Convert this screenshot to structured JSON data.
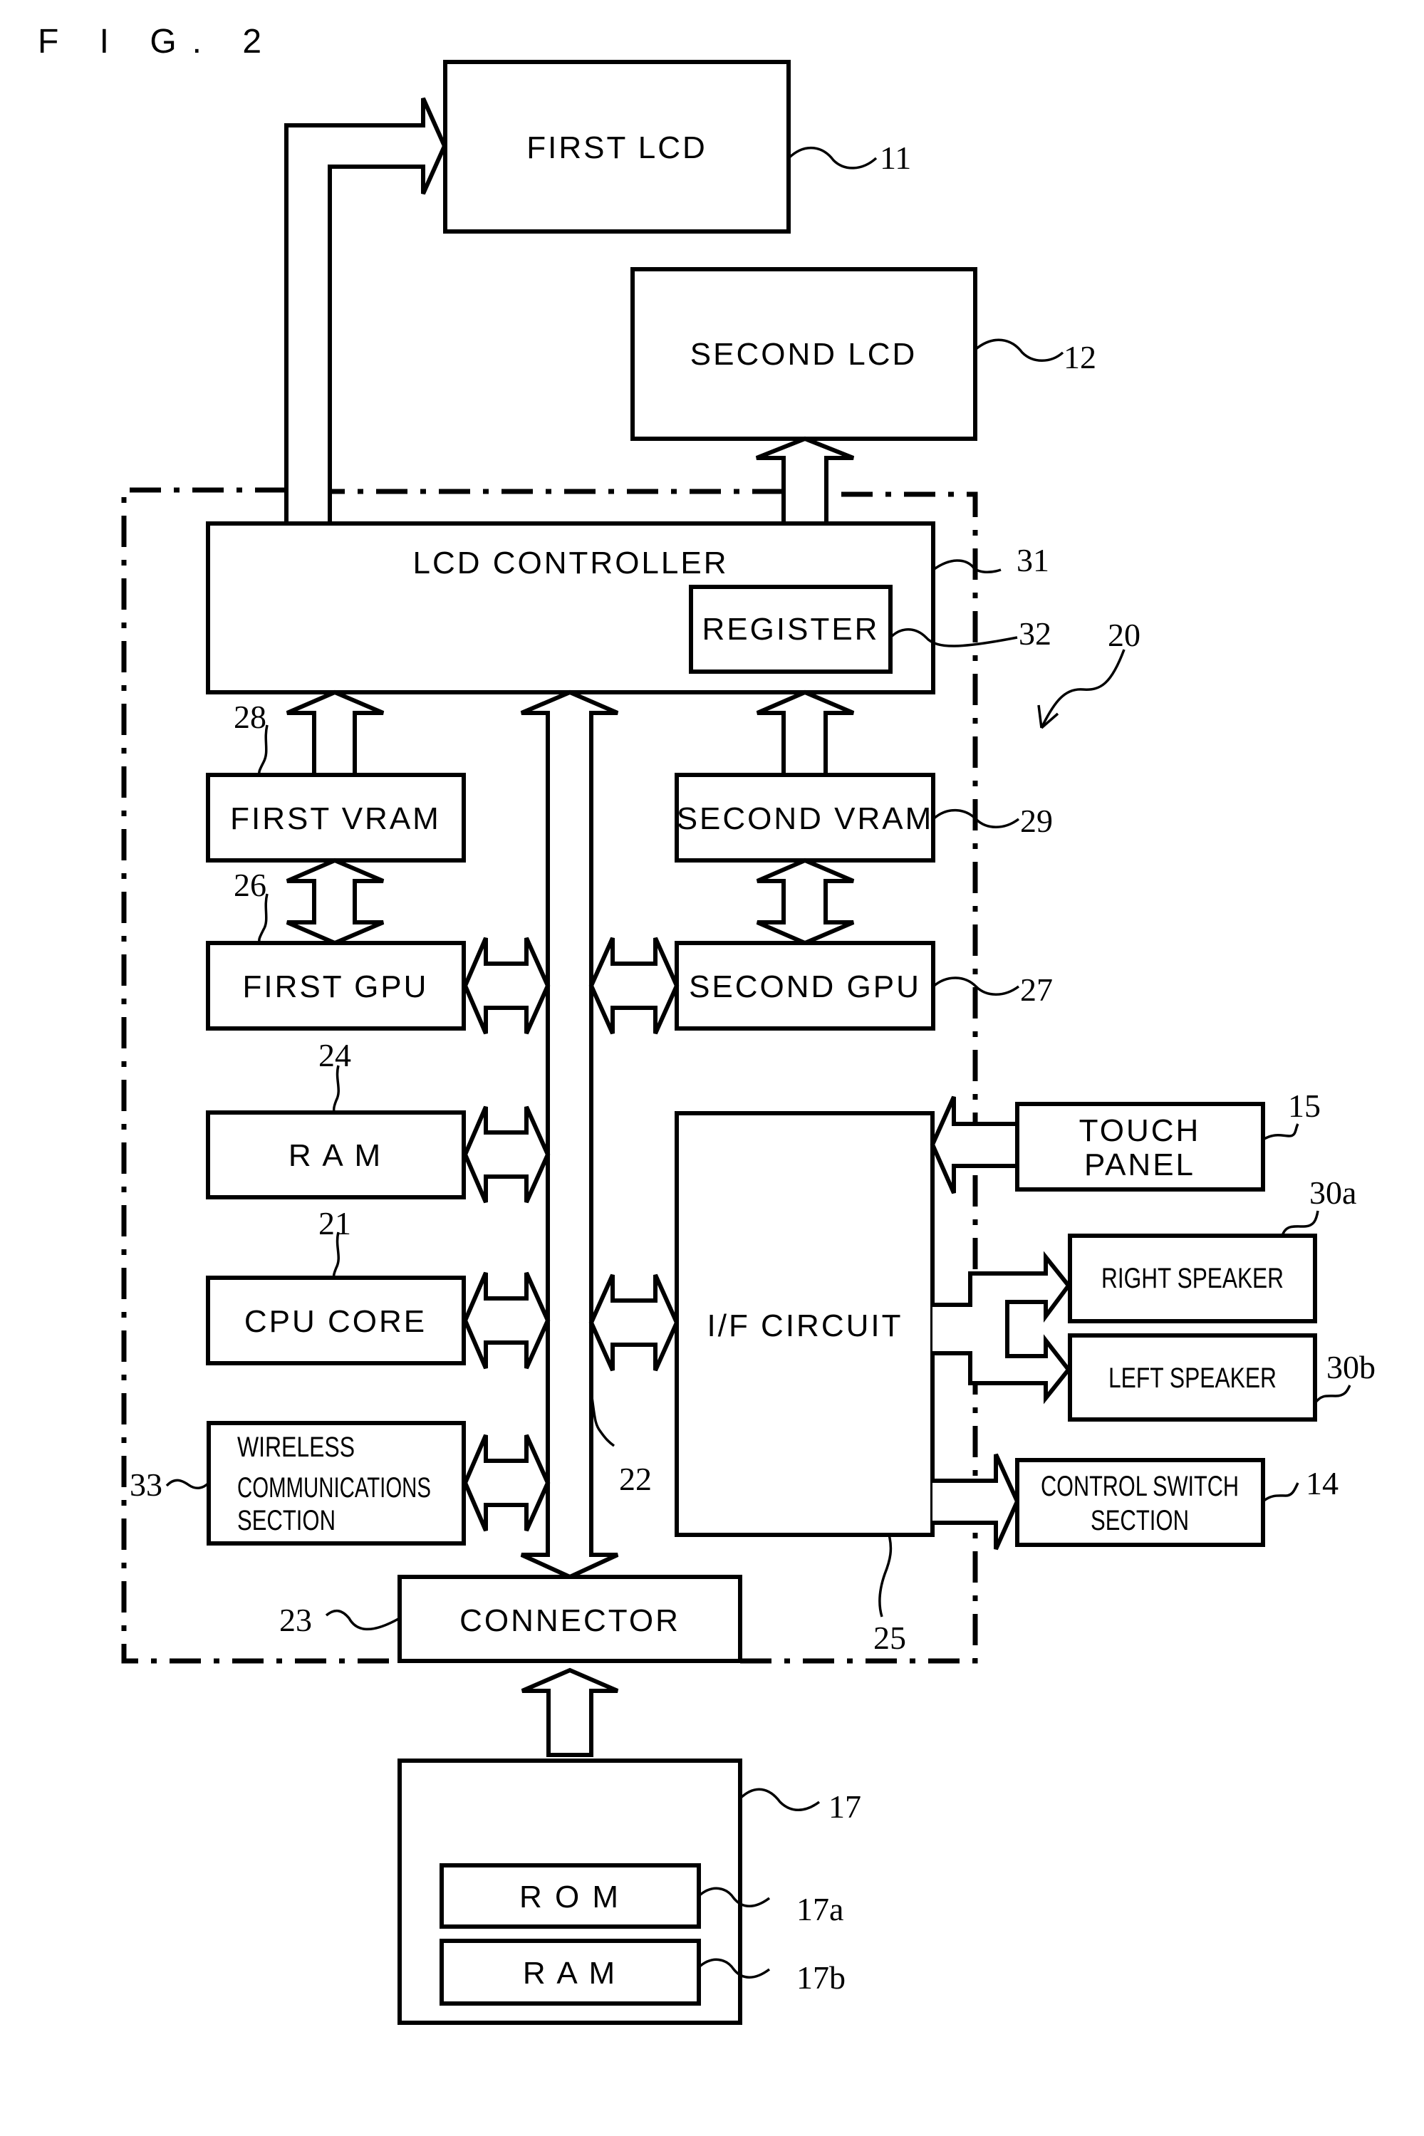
{
  "figure": {
    "title": "F I G. 2"
  },
  "blocks": {
    "first_lcd": "FIRST LCD",
    "second_lcd": "SECOND LCD",
    "lcd_controller": "LCD CONTROLLER",
    "register": "REGISTER",
    "first_vram": "FIRST VRAM",
    "second_vram": "SECOND VRAM",
    "first_gpu": "FIRST GPU",
    "second_gpu": "SECOND GPU",
    "ram": "R A M",
    "cpu_core": "CPU CORE",
    "wireless": [
      "WIRELESS",
      "COMMUNICATIONS",
      "SECTION"
    ],
    "if_circuit": "I/F CIRCUIT",
    "touch_panel": [
      "TOUCH",
      "PANEL"
    ],
    "right_speaker": "RIGHT SPEAKER",
    "left_speaker": "LEFT SPEAKER",
    "control_switch": [
      "CONTROL SWITCH",
      "SECTION"
    ],
    "connector": "CONNECTOR",
    "rom": "R O M",
    "cart_ram": "R A M"
  },
  "refs": {
    "first_lcd": "11",
    "second_lcd": "12",
    "control_switch": "14",
    "touch_panel": "15",
    "cartridge": "17",
    "rom": "17a",
    "cart_ram": "17b",
    "board": "20",
    "cpu_core": "21",
    "bus": "22",
    "connector": "23",
    "ram": "24",
    "if_circuit": "25",
    "first_gpu": "26",
    "second_gpu": "27",
    "first_vram": "28",
    "second_vram": "29",
    "right_speaker": "30a",
    "left_speaker": "30b",
    "lcd_controller": "31",
    "register": "32",
    "wireless": "33"
  }
}
